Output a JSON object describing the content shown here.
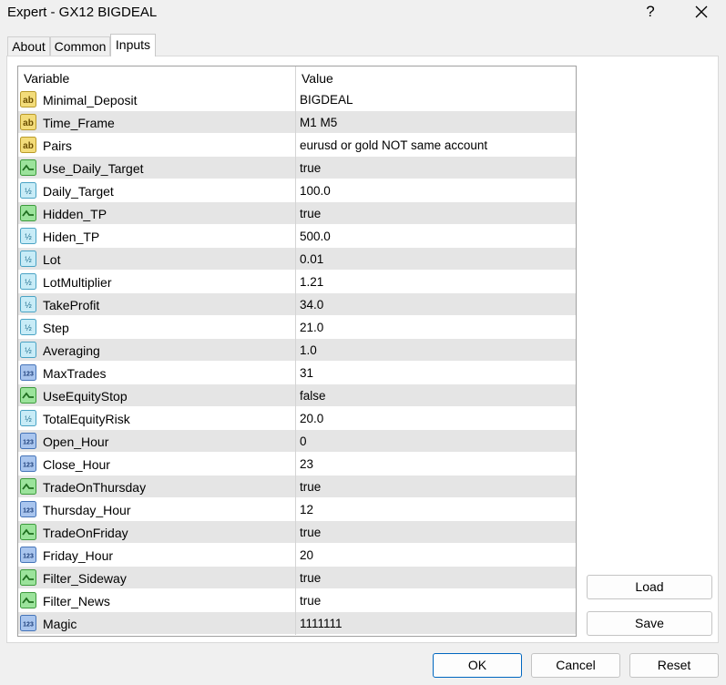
{
  "window": {
    "title": "Expert - GX12 BIGDEAL",
    "help": "?"
  },
  "tabs": [
    "About",
    "Common",
    "Inputs"
  ],
  "active_tab": "Inputs",
  "grid": {
    "headers": {
      "variable": "Variable",
      "value": "Value"
    },
    "rows": [
      {
        "type": "string",
        "icon": "string-type-icon",
        "name": "Minimal_Deposit",
        "value": "BIGDEAL"
      },
      {
        "type": "string",
        "icon": "string-type-icon",
        "name": "Time_Frame",
        "value": "M1 M5"
      },
      {
        "type": "string",
        "icon": "string-type-icon",
        "name": "Pairs",
        "value": "eurusd or gold NOT same account"
      },
      {
        "type": "bool",
        "icon": "boolean-type-icon",
        "name": "Use_Daily_Target",
        "value": "true"
      },
      {
        "type": "double",
        "icon": "double-type-icon",
        "name": "Daily_Target",
        "value": "100.0"
      },
      {
        "type": "bool",
        "icon": "boolean-type-icon",
        "name": "Hidden_TP",
        "value": "true"
      },
      {
        "type": "double",
        "icon": "double-type-icon",
        "name": "Hiden_TP",
        "value": "500.0"
      },
      {
        "type": "double",
        "icon": "double-type-icon",
        "name": "Lot",
        "value": "0.01"
      },
      {
        "type": "double",
        "icon": "double-type-icon",
        "name": "LotMultiplier",
        "value": "1.21"
      },
      {
        "type": "double",
        "icon": "double-type-icon",
        "name": "TakeProfit",
        "value": "34.0"
      },
      {
        "type": "double",
        "icon": "double-type-icon",
        "name": "Step",
        "value": "21.0"
      },
      {
        "type": "double",
        "icon": "double-type-icon",
        "name": "Averaging",
        "value": "1.0"
      },
      {
        "type": "int",
        "icon": "integer-type-icon",
        "name": "MaxTrades",
        "value": "31"
      },
      {
        "type": "bool",
        "icon": "boolean-type-icon",
        "name": "UseEquityStop",
        "value": "false"
      },
      {
        "type": "double",
        "icon": "double-type-icon",
        "name": "TotalEquityRisk",
        "value": "20.0"
      },
      {
        "type": "int",
        "icon": "integer-type-icon",
        "name": "Open_Hour",
        "value": "0"
      },
      {
        "type": "int",
        "icon": "integer-type-icon",
        "name": "Close_Hour",
        "value": "23"
      },
      {
        "type": "bool",
        "icon": "boolean-type-icon",
        "name": "TradeOnThursday",
        "value": "true"
      },
      {
        "type": "int",
        "icon": "integer-type-icon",
        "name": "Thursday_Hour",
        "value": "12"
      },
      {
        "type": "bool",
        "icon": "boolean-type-icon",
        "name": "TradeOnFriday",
        "value": "true"
      },
      {
        "type": "int",
        "icon": "integer-type-icon",
        "name": "Friday_Hour",
        "value": "20"
      },
      {
        "type": "bool",
        "icon": "boolean-type-icon",
        "name": "Filter_Sideway",
        "value": "true"
      },
      {
        "type": "bool",
        "icon": "boolean-type-icon",
        "name": "Filter_News",
        "value": "true"
      },
      {
        "type": "int",
        "icon": "integer-type-icon",
        "name": "Magic",
        "value": "1111111"
      }
    ]
  },
  "side_buttons": {
    "load": "Load",
    "save": "Save"
  },
  "footer_buttons": {
    "ok": "OK",
    "cancel": "Cancel",
    "reset": "Reset"
  },
  "colors": {
    "row_alt": "#e5e5e5",
    "ok_border": "#0067c0"
  }
}
